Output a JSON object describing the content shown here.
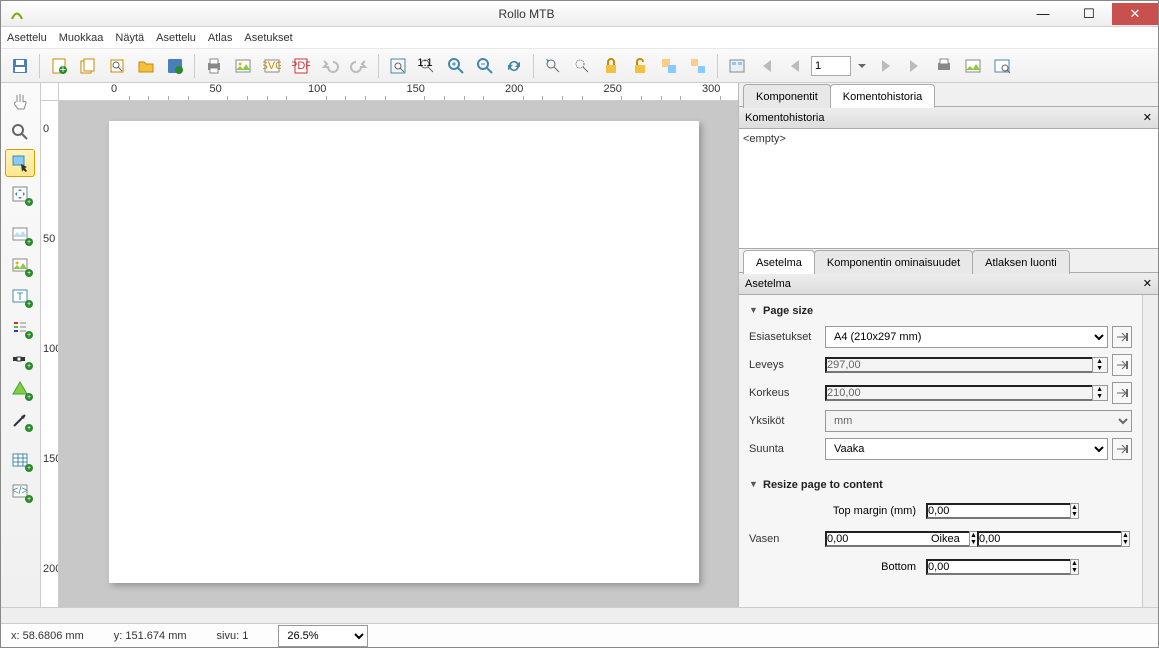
{
  "app": {
    "title": "Rollo MTB"
  },
  "menu": [
    "Asettelu",
    "Muokkaa",
    "Näytä",
    "Asettelu",
    "Atlas",
    "Asetukset"
  ],
  "toolbar_page_input": "1",
  "right": {
    "tabs_top": [
      "Komponentit",
      "Komentohistoria"
    ],
    "active_top": 1,
    "history_title": "Komentohistoria",
    "history_empty": "<empty>",
    "tabs_mid": [
      "Asetelma",
      "Komponentin ominaisuudet",
      "Atlaksen luonti"
    ],
    "active_mid": 0,
    "asetelma_title": "Asetelma",
    "group_pagesize": "Page size",
    "esiasetukset_lbl": "Esiasetukset",
    "esiasetukset_val": "A4 (210x297 mm)",
    "leveys_lbl": "Leveys",
    "leveys_val": "297,00",
    "korkeus_lbl": "Korkeus",
    "korkeus_val": "210,00",
    "yksikot_lbl": "Yksiköt",
    "yksikot_val": "mm",
    "suunta_lbl": "Suunta",
    "suunta_val": "Vaaka",
    "group_resize": "Resize page to content",
    "topmargin_lbl": "Top margin (mm)",
    "topmargin_val": "0,00",
    "vasen_lbl": "Vasen",
    "vasen_val": "0,00",
    "oikea_lbl": "Oikea",
    "oikea_val": "0,00",
    "bottom_lbl": "Bottom",
    "bottom_val": "0,00"
  },
  "status": {
    "x": "x: 58.6806 mm",
    "y": "y: 151.674 mm",
    "sivu": "sivu: 1",
    "zoom": "26.5%"
  },
  "ruler_h": [
    0,
    50,
    100,
    150,
    200,
    250,
    300
  ],
  "ruler_v": [
    0,
    50,
    100,
    150,
    200
  ],
  "colors": {
    "accent": "#c8504e"
  }
}
